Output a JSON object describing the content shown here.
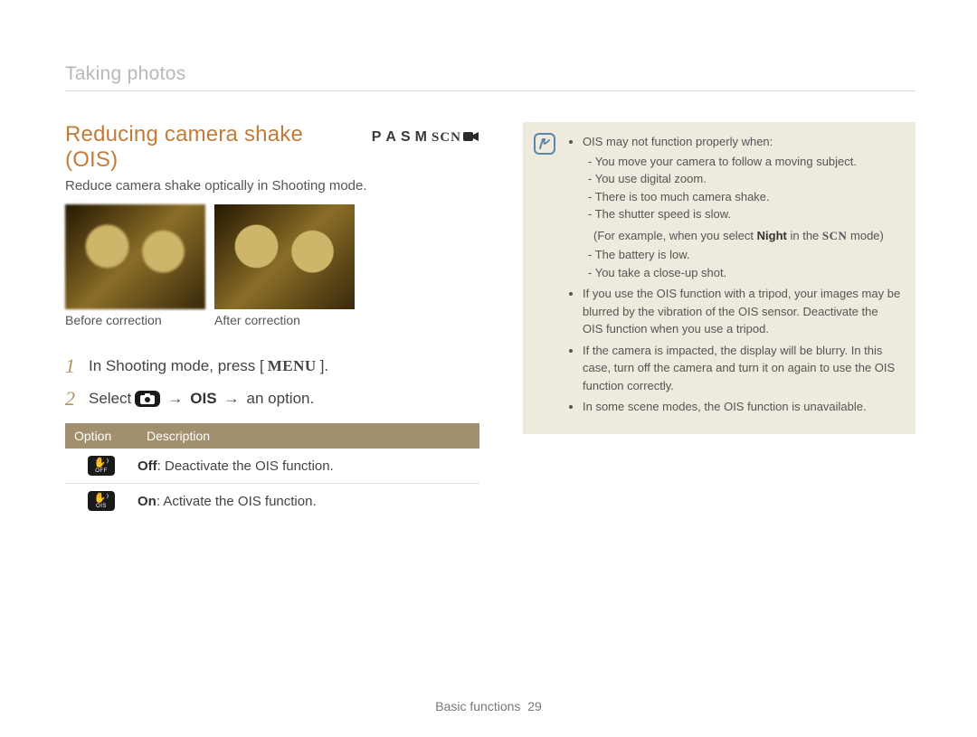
{
  "breadcrumb": "Taking photos",
  "heading": "Reducing camera shake (OIS)",
  "mode_badges": {
    "p": "P",
    "a": "A",
    "s": "S",
    "m": "M",
    "scn": "SCN"
  },
  "intro": "Reduce camera shake optically in Shooting mode.",
  "captions": {
    "before": "Before correction",
    "after": "After correction"
  },
  "steps": {
    "one_num": "1",
    "one_a": "In Shooting mode, press [",
    "one_menu": "MENU",
    "one_b": "].",
    "two_num": "2",
    "two_a": "Select",
    "two_ois": "OIS",
    "two_b": "an option.",
    "arrow": "→"
  },
  "table": {
    "h1": "Option",
    "h2": "Description",
    "rows": [
      {
        "icon_sub": "OFF",
        "lead": "Off",
        "desc": ": Deactivate the OIS function."
      },
      {
        "icon_sub": "OIS",
        "lead": "On",
        "desc": ": Activate the OIS function."
      }
    ]
  },
  "notes": {
    "b1": "OIS may not function properly when:",
    "sub": [
      "You move your camera to follow a moving subject.",
      "You use digital zoom.",
      "There is too much camera shake.",
      "The shutter speed is slow."
    ],
    "paren_a": "(For example, when you select ",
    "paren_bold": "Night",
    "paren_b": " in the ",
    "paren_scn": "SCN",
    "paren_c": " mode)",
    "sub2": [
      "The battery is low.",
      "You take a close-up shot."
    ],
    "b2": "If you use the OIS function with a tripod, your images may be blurred by the vibration of the OIS sensor. Deactivate the OIS function when you use a tripod.",
    "b3": "If the camera is impacted, the display will be blurry. In this case, turn off the camera and turn it on again to use the OIS function correctly.",
    "b4": "In some scene modes, the OIS function is unavailable."
  },
  "footer": {
    "section": "Basic functions",
    "page": "29"
  }
}
